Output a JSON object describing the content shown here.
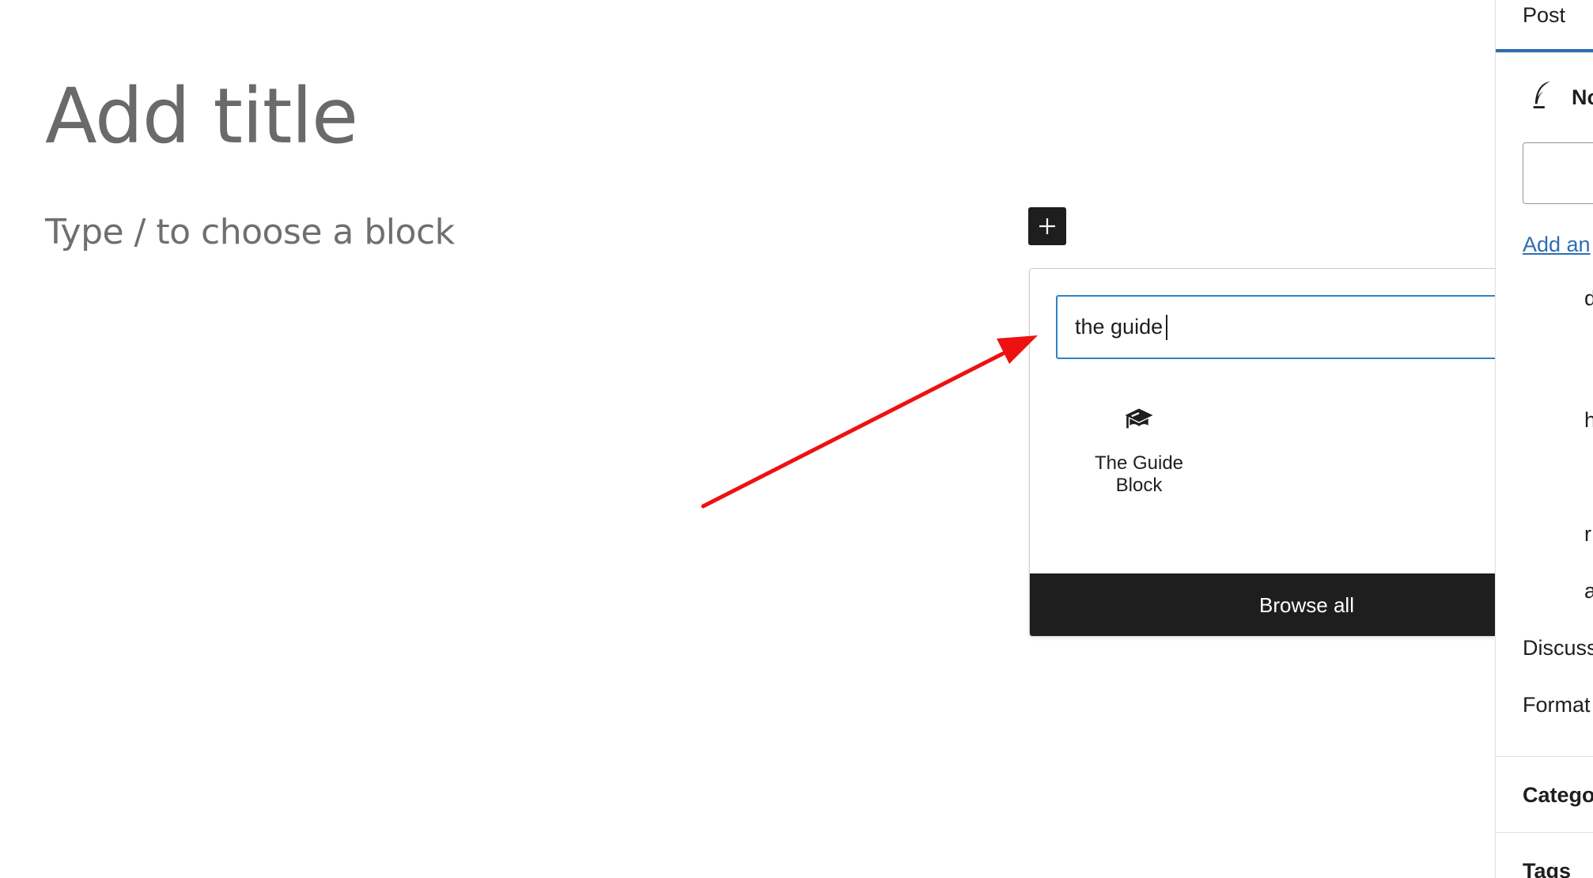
{
  "editor": {
    "title_placeholder": "Add title",
    "block_placeholder": "Type / to choose a block"
  },
  "inserter": {
    "search_value": "the guide",
    "results": [
      {
        "label_line1": "The Guide",
        "label_line2": "Block",
        "icon": "graduation-cap-icon"
      }
    ],
    "browse_all_label": "Browse all"
  },
  "annotation": {
    "color": "#ee1111"
  },
  "sidebar": {
    "tab_label": "Post",
    "status_label": "No",
    "link_label": "Add an",
    "fragments": [
      "d",
      "h",
      "r",
      "a"
    ],
    "discussion_label": "Discuss",
    "format_label": "Format",
    "categories_label": "Catego",
    "tags_label": "Tags"
  },
  "colors": {
    "accent": "#2f82c4",
    "link": "#2f6db2",
    "dark": "#1e1e1e"
  }
}
